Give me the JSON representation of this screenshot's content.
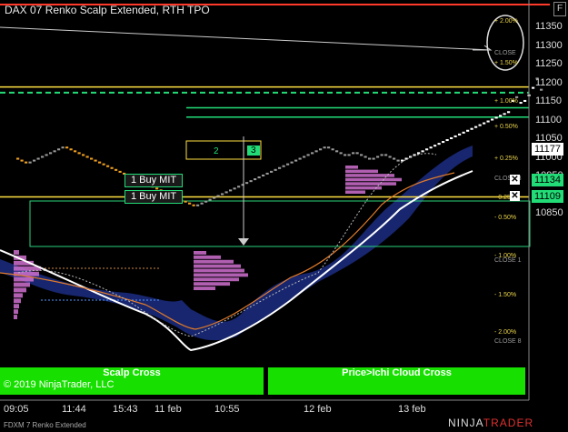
{
  "window": {
    "title": "DAX 07 Renko Scalp Extended, RTH TPO",
    "corner_button": "F"
  },
  "price_axis": {
    "labels": [
      "11350",
      "11300",
      "11250",
      "11200",
      "11150",
      "11100",
      "11050",
      "11000",
      "10950",
      "10900",
      "10850"
    ],
    "current_price": "11177",
    "order_prices": [
      "11134",
      "11109"
    ]
  },
  "percent_labels": [
    "+ 2.00%",
    "CLOSE",
    "+ 1.50%",
    "+ 1.00%",
    "+ 0.50%",
    "+ 0.25%",
    "CLOSE 3",
    "- 0.25%",
    "- 0.50%",
    "- 1.00%",
    "CLOSE 1",
    "- 1.50%",
    "- 2.00%",
    "CLOSE 8",
    "- 2.50%"
  ],
  "time_axis": {
    "labels": [
      "09:05",
      "11:44",
      "15:43",
      "11 feb",
      "10:55",
      "12 feb",
      "13 feb"
    ]
  },
  "orders": [
    {
      "label": "1  Buy MIT",
      "price": "11134"
    },
    {
      "label": "1  Buy MIT",
      "price": "11109"
    }
  ],
  "box_numbers": [
    "2",
    "3"
  ],
  "banners": {
    "left": "Scalp Cross",
    "right": "Price>Ichi Cloud Cross"
  },
  "copyright": "© 2019 NinjaTrader, LLC",
  "footer": {
    "instrument": "FDXM 7 Renko Extended",
    "brand_main": "NINJA",
    "brand_accent": "TRADER"
  },
  "colors": {
    "background": "#000000",
    "bull_brick": "#ffffff",
    "bear_brick": "#f0a020",
    "neutral_brick": "#9a9a9a",
    "tpo_profile": "#d070d0",
    "cloud": "#1a2a7a",
    "order_line": "#22dd77",
    "yellow_line": "#ffe040",
    "signal_banner": "#17e000",
    "top_red_line": "#ff3a2a"
  },
  "chart_data": {
    "type": "candlestick",
    "y_axis": {
      "ylim": [
        10830,
        11375
      ],
      "ticks": [
        11350,
        11300,
        11250,
        11200,
        11150,
        11100,
        11050,
        11000,
        10950,
        10900,
        10850
      ]
    },
    "brick_size": 5,
    "renko_path": [
      11000,
      10985,
      11000,
      11030,
      11010,
      10975,
      10955,
      10935,
      10905,
      10870,
      10900,
      10920,
      10940,
      10960,
      10985,
      11010,
      11030,
      11005,
      11015,
      10995,
      11010,
      11000,
      10990,
      11010,
      11040,
      11080,
      11115,
      11150,
      11165,
      11145,
      11150,
      11165,
      11185,
      11215,
      11185,
      11175
    ],
    "levels": {
      "current": 11177,
      "buy_mit_1": 11134,
      "buy_mit_2": 11109,
      "yellow_upper": 11190,
      "yellow_lower": 10895
    }
  }
}
